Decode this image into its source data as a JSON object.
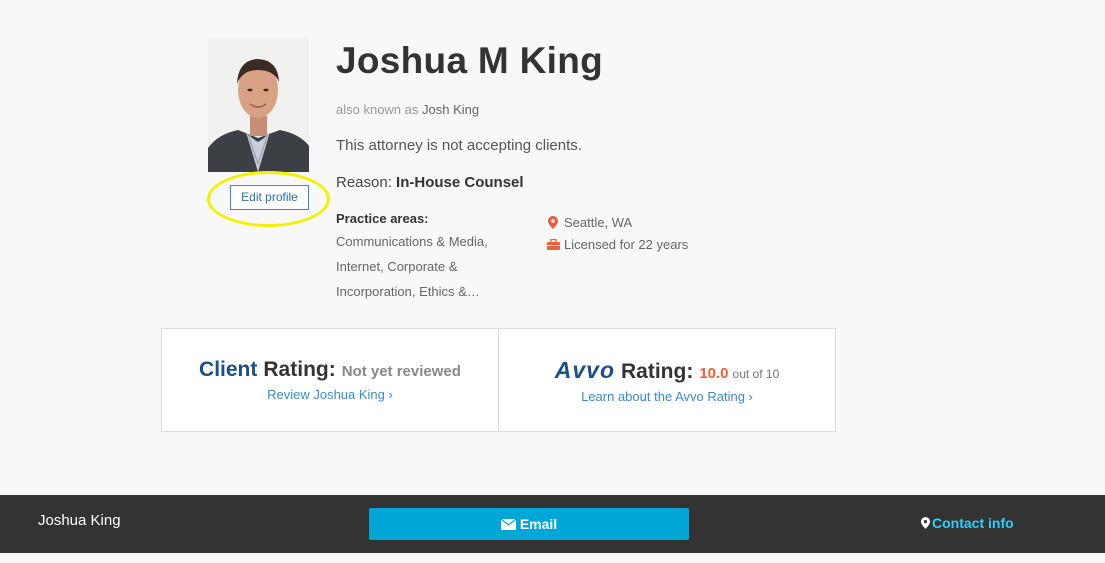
{
  "profile": {
    "name": "Joshua M King",
    "aka_prefix": "also known as",
    "aka_name": "Josh King",
    "status": "This attorney is not accepting clients.",
    "reason_label": "Reason:",
    "reason_value": "In-House Counsel",
    "edit_button": "Edit profile",
    "practice_label": "Practice areas:",
    "practice_areas": "Communications & Media, Internet, Corporate & Incorporation, Ethics &…",
    "location": "Seattle, WA",
    "licensed": "Licensed for 22 years"
  },
  "ratings": {
    "client_word": "Client",
    "client_rating_word": "Rating:",
    "client_status": "Not yet reviewed",
    "client_link": "Review Joshua King",
    "avvo_logo": "Avvo",
    "avvo_rating_word": "Rating:",
    "avvo_score": "10.0",
    "avvo_outof": "out of 10",
    "avvo_link": "Learn about the Avvo Rating"
  },
  "footer": {
    "name": "Joshua King",
    "email_button": "Email",
    "contact_link": "Contact info"
  },
  "icons": {
    "location": "map-pin-icon",
    "licensed": "briefcase-icon",
    "email": "envelope-icon",
    "contact": "map-pin-icon",
    "chevron": "chevron-right-icon"
  },
  "colors": {
    "accent_blue": "#3a8cc8",
    "brand_navy": "#1b4f86",
    "score_orange": "#e8603c",
    "email_button": "#00a6d6",
    "footer_bg": "#333333",
    "highlight": "#f2f200"
  }
}
